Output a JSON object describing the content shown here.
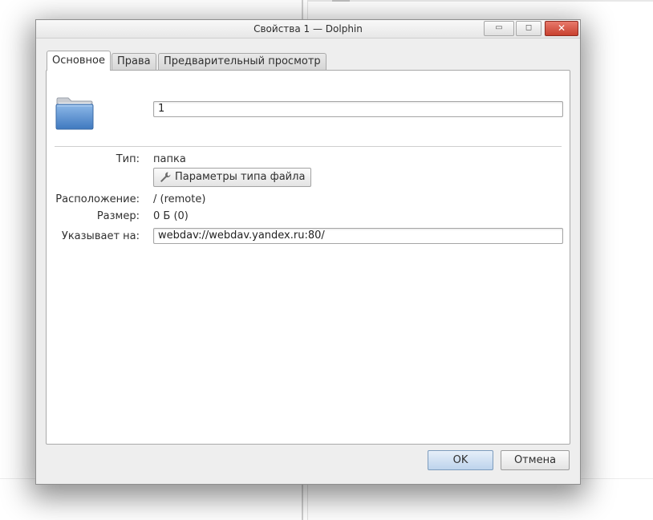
{
  "window": {
    "title": "Свойства 1 — Dolphin"
  },
  "titlebar_buttons": {
    "minimize": "▭",
    "maximize": "◻",
    "close": "✕"
  },
  "tabs": [
    {
      "label": "Основное",
      "active": true
    },
    {
      "label": "Права",
      "active": false
    },
    {
      "label": "Предварительный просмотр",
      "active": false
    }
  ],
  "general": {
    "icon": "folder-icon",
    "name_value": "1",
    "type_label": "Тип:",
    "type_value": "папка",
    "filetype_button": "Параметры типа файла",
    "location_label": "Расположение:",
    "location_value": "/ (remote)",
    "size_label": "Размер:",
    "size_value": "0 Б (0)",
    "points_to_label": "Указывает на:",
    "points_to_value": "webdav://webdav.yandex.ru:80/"
  },
  "buttons": {
    "ok": "OK",
    "cancel": "Отмена"
  },
  "colors": {
    "folder": "#5b8fcf",
    "close_button": "#d3533f",
    "ok_button": "#c9dbef"
  }
}
